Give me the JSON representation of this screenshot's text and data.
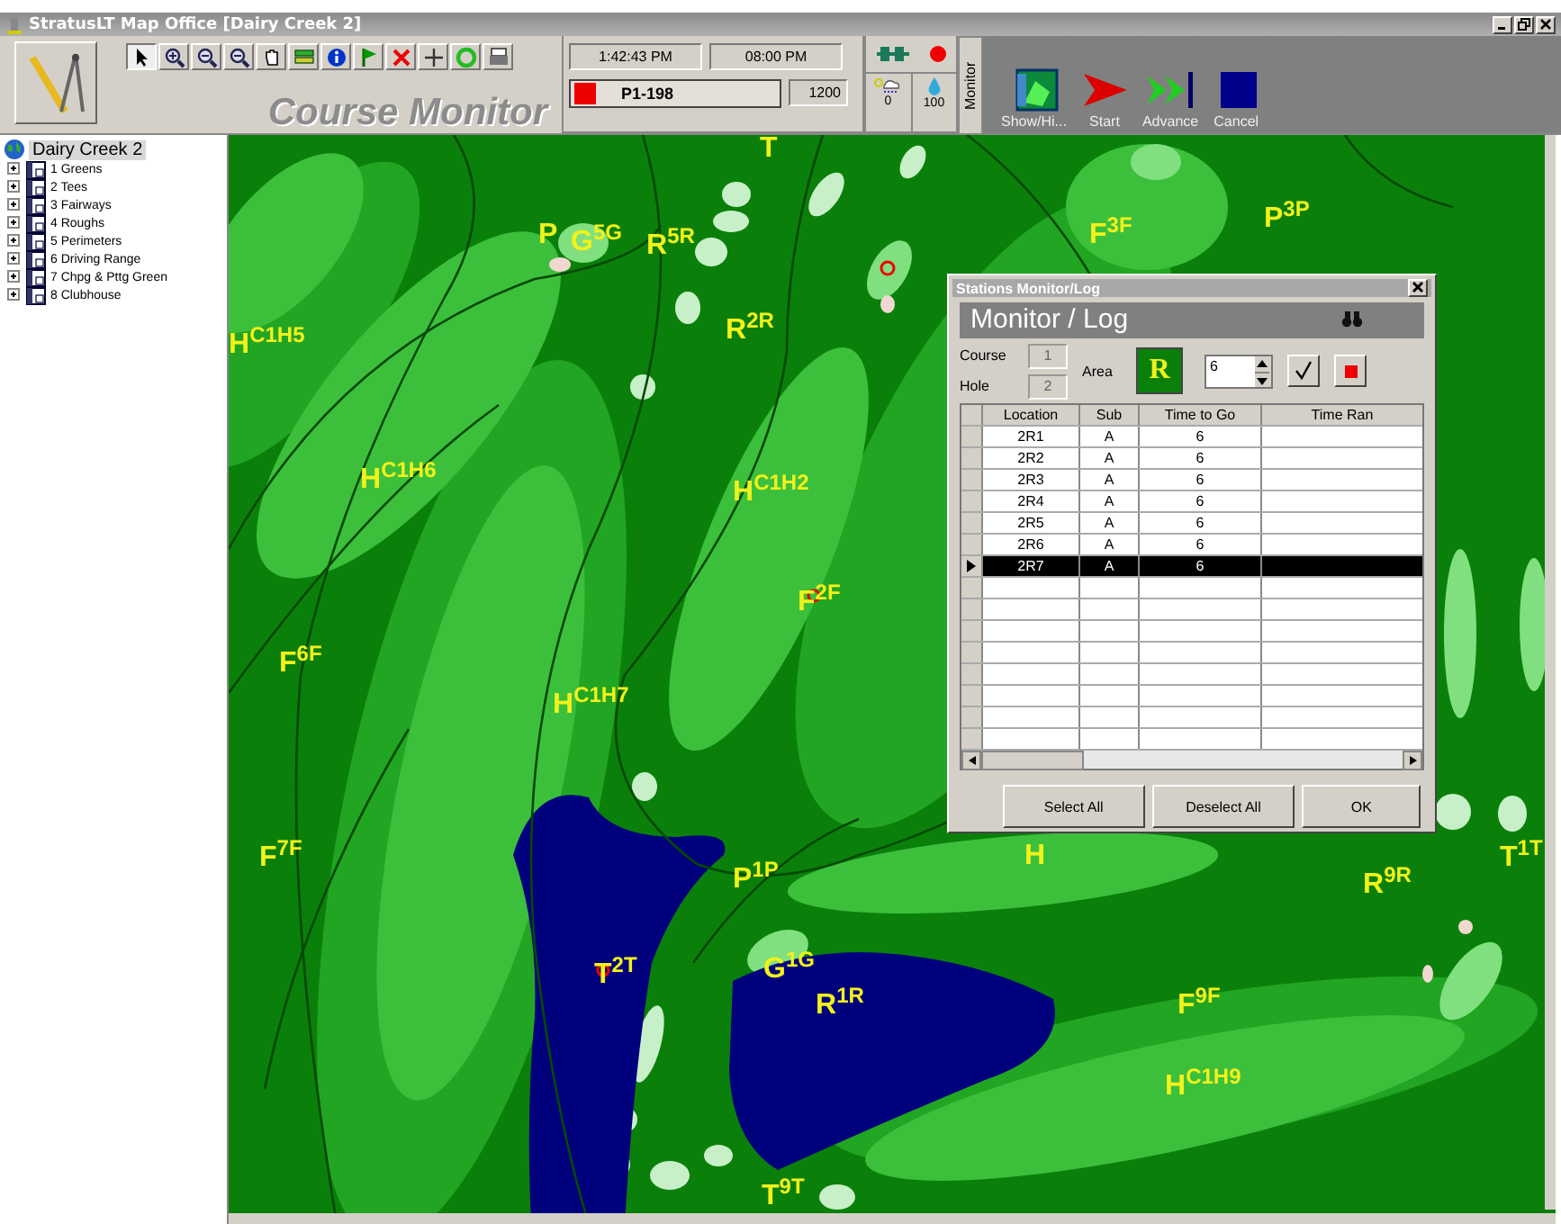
{
  "window": {
    "title": "StratusLT Map Office [Dairy Creek 2]"
  },
  "toolbar": {
    "app_title": "Course Monitor",
    "time": "1:42:43 PM",
    "end_time": "08:00 PM",
    "program": "P1-198",
    "program_value": "1200",
    "rain": "0",
    "water": "100",
    "monitor_label": "Monitor",
    "actions": [
      {
        "label": "Show/Hi...",
        "kind": "show"
      },
      {
        "label": "Start",
        "kind": "start"
      },
      {
        "label": "Advance",
        "kind": "advance"
      },
      {
        "label": "Cancel",
        "kind": "cancel"
      }
    ]
  },
  "tree": {
    "root": "Dairy Creek 2",
    "items": [
      {
        "label": "1 Greens",
        "expanded": false
      },
      {
        "label": "2 Tees",
        "expanded": false
      },
      {
        "label": "3 Fairways",
        "expanded": false
      },
      {
        "label": "4 Roughs",
        "expanded": false
      },
      {
        "label": "5 Perimeters",
        "expanded": false
      },
      {
        "label": "6 Driving Range",
        "expanded": false
      },
      {
        "label": "7 Chpg & Pttg Green",
        "expanded": false
      },
      {
        "label": "8 Clubhouse",
        "expanded": false
      }
    ]
  },
  "map": {
    "labels": [
      "T",
      "P",
      "G$^{5G}$",
      "R$^{5R}$",
      "R$^{2R}$",
      "F$^{3F}$",
      "P$^{3P}$",
      "H$^{C1H5}$",
      "H$^{C1H6}$",
      "H$^{C1H2}$",
      "F$^{2F}$",
      "F$^{6F}$",
      "H$^{C1H7}$",
      "F$^{7F}$",
      "P$^{1P}$",
      "H",
      "R$^{9R}$",
      "T$^{1T}$",
      "T$^{2T}$",
      "G$^{1G}$",
      "R$^{1R}$",
      "F$^{9F}$",
      "H$^{C1H9}$",
      "T$^{9T}$"
    ]
  },
  "dialog": {
    "title": "Stations Monitor/Log",
    "heading": "Monitor / Log",
    "course_label": "Course",
    "course": "1",
    "hole_label": "Hole",
    "hole": "2",
    "area_label": "Area",
    "area": "R",
    "minutes": "6",
    "columns": [
      "Location",
      "Sub",
      "Time to Go",
      "Time Ran"
    ],
    "rows": [
      {
        "cells": [
          "2R1",
          "A",
          "6"
        ],
        "selected": false
      },
      {
        "cells": [
          "2R2",
          "A",
          "6"
        ],
        "selected": false
      },
      {
        "cells": [
          "2R3",
          "A",
          "6"
        ],
        "selected": false
      },
      {
        "cells": [
          "2R4",
          "A",
          "6"
        ],
        "selected": false
      },
      {
        "cells": [
          "2R5",
          "A",
          "6"
        ],
        "selected": false
      },
      {
        "cells": [
          "2R6",
          "A",
          "6"
        ],
        "selected": false
      },
      {
        "cells": [
          "2R7",
          "A",
          "6"
        ],
        "selected": true
      }
    ],
    "buttons": [
      "Select All",
      "Deselect All",
      "OK"
    ]
  }
}
